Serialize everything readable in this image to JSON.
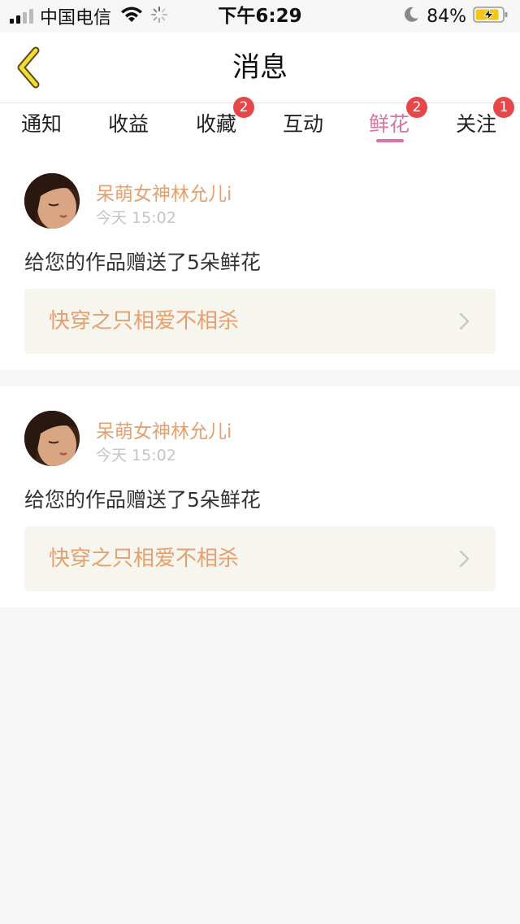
{
  "status_bar": {
    "carrier": "中国电信",
    "time": "下午6:29",
    "battery_percent": "84%",
    "signal_bars": 2,
    "icons": [
      "signal-icon",
      "wifi-icon",
      "loading-spinner-icon",
      "moon-icon",
      "battery-charging-icon"
    ]
  },
  "header": {
    "title": "消息",
    "back_icon": "chevron-left-icon"
  },
  "tabs": [
    {
      "label": "通知",
      "badge": ""
    },
    {
      "label": "收益",
      "badge": ""
    },
    {
      "label": "收藏",
      "badge": "2"
    },
    {
      "label": "互动",
      "badge": ""
    },
    {
      "label": "鲜花",
      "badge": "2",
      "active": true
    },
    {
      "label": "关注",
      "badge": "1"
    }
  ],
  "messages": [
    {
      "username": "呆萌女神林允儿i",
      "time": "今天 15:02",
      "text": "给您的作品赠送了5朵鲜花",
      "work_title": "快穿之只相爱不相杀"
    },
    {
      "username": "呆萌女神林允儿i",
      "time": "今天 15:02",
      "text": "给您的作品赠送了5朵鲜花",
      "work_title": "快穿之只相爱不相杀"
    }
  ],
  "colors": {
    "accent_pink": "#d973a3",
    "username_orange": "#e5a06f",
    "badge_red": "#e8474a",
    "back_arrow_yellow": "#f2dd36",
    "work_box_bg": "#f6f5ee"
  }
}
